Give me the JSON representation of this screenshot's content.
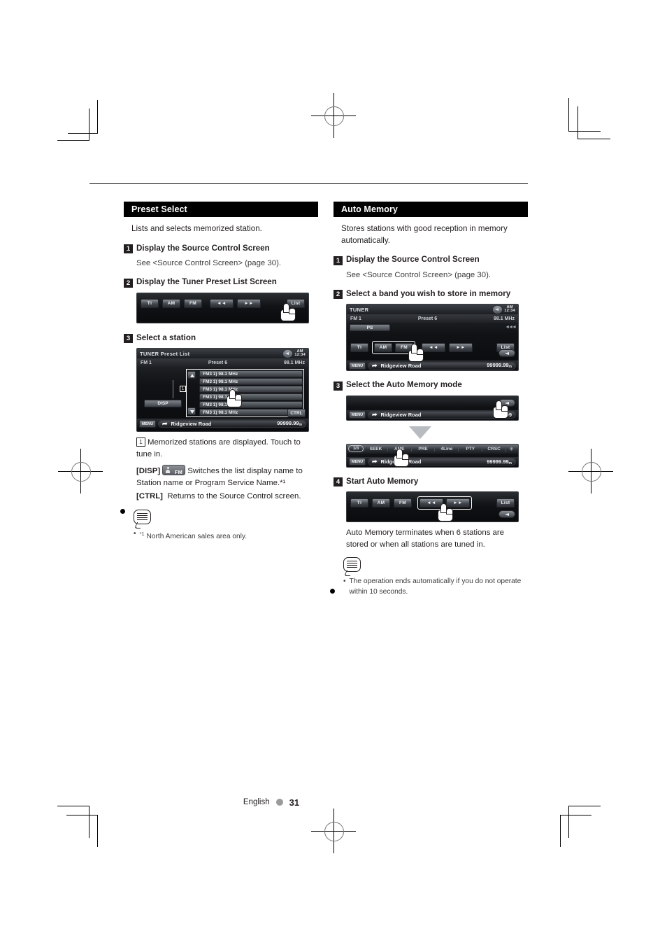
{
  "page": {
    "language": "English",
    "number": "31"
  },
  "left_section": {
    "heading": "Preset Select",
    "lede": "Lists and selects memorized station.",
    "steps": [
      {
        "num": "1",
        "title": "Display the Source Control Screen",
        "sub": "See <Source Control Screen> (page 30)."
      },
      {
        "num": "2",
        "title": "Display the Tuner Preset List Screen"
      },
      {
        "num": "3",
        "title": "Select a station"
      }
    ],
    "callout_num": "1",
    "callout_text": "Memorized stations are displayed. Touch to tune in.",
    "disp_key": "[DISP]",
    "disp_text": "Switches the list display name to Station name or Program Service Name.*¹",
    "ctrl_key": "[CTRL]",
    "ctrl_text": "Returns to the Source Control screen.",
    "note": {
      "marker": "*1",
      "text": "North American sales area only."
    },
    "lcd_step2": {
      "buttons": [
        "TI",
        "AM",
        "FM"
      ],
      "seek_prev": "◄◄",
      "seek_next": "►►",
      "list_label": "List"
    },
    "lcd_step3": {
      "title": "TUNER Preset List",
      "clock_ampm": "AM",
      "clock_time": "12:34",
      "band": "FM 1",
      "preset": "Preset 6",
      "freq": "98.1 MHz",
      "disp_label": "DISP",
      "ctrl_label": "CTRL",
      "tag": "1",
      "rows": [
        "FM3 1) 98.1 MHz",
        "FM3 1) 98.1 MHz",
        "FM3 1) 98.1 MHz",
        "FM3 1) 98.1 MHz",
        "FM3 1) 98.1 MHz",
        "FM3 1) 98.1 MHz"
      ],
      "menu_label": "MENU",
      "road": "Ridgeview Road",
      "distance": "99999.99",
      "distance_unit": "m"
    }
  },
  "right_section": {
    "heading": "Auto Memory",
    "lede": "Stores stations with good reception in memory automatically.",
    "steps": [
      {
        "num": "1",
        "title": "Display the Source Control Screen",
        "sub": "See <Source Control Screen> (page 30)."
      },
      {
        "num": "2",
        "title": "Select a band you wish to store in memory"
      },
      {
        "num": "3",
        "title": "Select the Auto Memory mode"
      },
      {
        "num": "4",
        "title": "Start Auto Memory"
      }
    ],
    "result_text": "Auto Memory terminates when 6 stations are stored or when all stations are tuned in.",
    "note": {
      "text": "The operation ends automatically if you do not operate within 10 seconds."
    },
    "lcd_step2": {
      "title": "TUNER",
      "clock_ampm": "AM",
      "clock_time": "12:34",
      "band": "FM 1",
      "preset": "Preset 6",
      "freq": "98.1 MHz",
      "ps_label": "PS",
      "buttons": [
        "TI",
        "AM",
        "FM"
      ],
      "seek_prev": "◄◄",
      "seek_next": "►►",
      "list_label": "List",
      "menu_label": "MENU",
      "road": "Ridgeview Road",
      "distance": "99999.99",
      "distance_unit": "m"
    },
    "lcd_step3a": {
      "menu_label": "MENU",
      "road": "Ridgeview Road",
      "distance": "99999"
    },
    "lcd_step3b": {
      "page_indicator": "1/3",
      "items": [
        "SEEK",
        "AME",
        "PRE",
        "4Line",
        "PTY",
        "CRSC"
      ],
      "close_icon": "✳",
      "menu_label": "MENU",
      "road": "Ridgeview Road",
      "distance": "99999.99",
      "distance_unit": "m"
    },
    "lcd_step4": {
      "buttons": [
        "TI",
        "AM",
        "FM"
      ],
      "seek_prev": "◄◄",
      "seek_next": "►►",
      "list_label": "List"
    }
  }
}
